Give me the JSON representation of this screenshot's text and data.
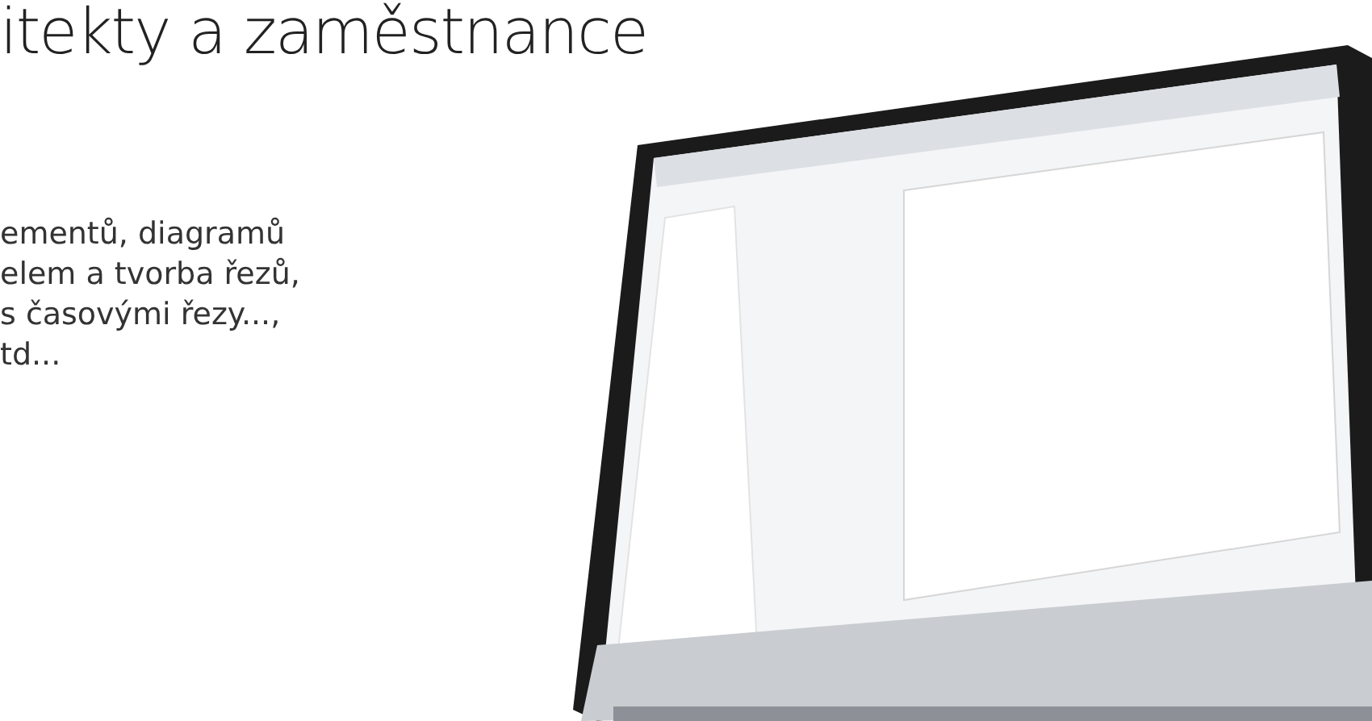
{
  "heading": "itekty a zaměstnance",
  "paragraph_lines": [
    "ementů, diagramů",
    "elem a tvorba řezů,",
    "s časovými řezy...,",
    "td..."
  ]
}
